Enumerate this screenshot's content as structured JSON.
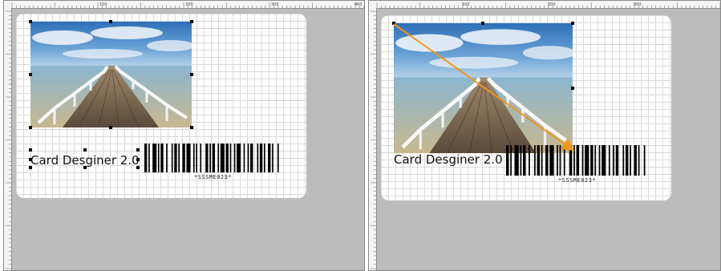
{
  "before": {
    "ruler": {
      "tick_labels": [
        "100",
        "200",
        "300",
        "400"
      ]
    },
    "card": {
      "title_text": "Card Desginer 2.0",
      "barcode_caption": "*SSSME023*"
    },
    "photo": {
      "icon": "pier-photo"
    }
  },
  "after": {
    "ruler": {
      "tick_labels": [
        "100",
        "200",
        "300"
      ]
    },
    "card": {
      "title_text": "Card Desginer 2.0",
      "barcode_caption": "*SSSME023*"
    },
    "photo": {
      "icon": "pier-photo"
    },
    "drag_arrow": {
      "color": "#f0961e",
      "icon": "arrow-icon"
    }
  },
  "colors": {
    "canvas_bg": "#bcbcbc",
    "card_bg": "#ffffff",
    "grid": "#d9d9d9",
    "selection_handle": "#000000",
    "arrow": "#f0961e"
  }
}
